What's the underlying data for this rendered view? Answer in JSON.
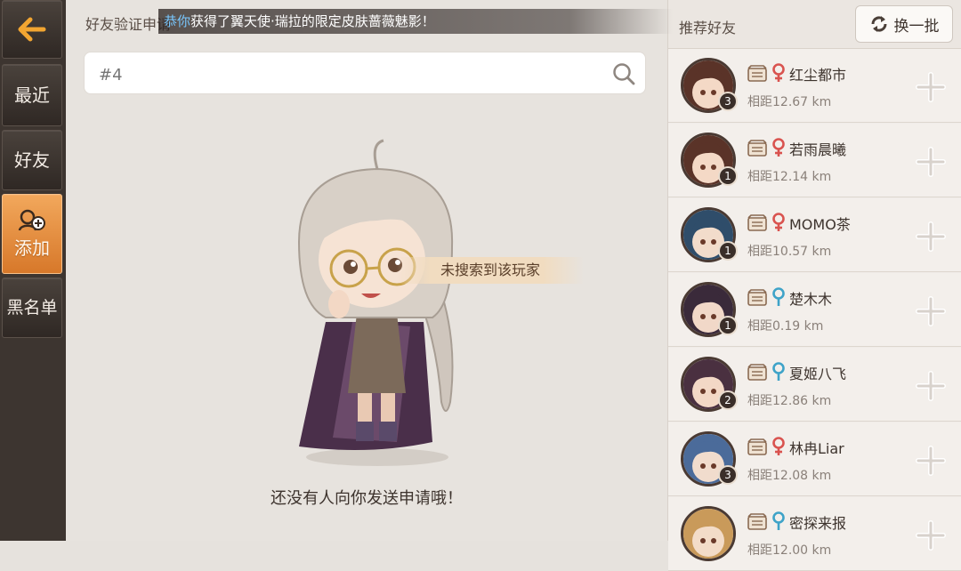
{
  "sidebar": {
    "back_label": "",
    "items": [
      {
        "label": "最近"
      },
      {
        "label": "好友"
      },
      {
        "label": "添加"
      },
      {
        "label": "黑名单"
      }
    ]
  },
  "main": {
    "title": "好友验证申请",
    "marquee_prefix": "恭你",
    "marquee_text": "获得了翼天使·瑞拉的限定皮肤蔷薇魅影！",
    "search_placeholder": "#4",
    "tip": "未搜索到该玩家",
    "empty_message": "还没有人向你发送申请哦！"
  },
  "recommend": {
    "title": "推荐好友",
    "refresh_label": "换一批",
    "items": [
      {
        "name": "红尘都市",
        "distance": "相距12.67 km",
        "level": "3",
        "gender": "female",
        "avatar_hair": "#5a3328",
        "avatar_skin": "#f4d9c6"
      },
      {
        "name": "若雨晨曦",
        "distance": "相距12.14 km",
        "level": "1",
        "gender": "female",
        "avatar_hair": "#5a3328",
        "avatar_skin": "#f4d9c6"
      },
      {
        "name": "MOMO茶",
        "distance": "相距10.57 km",
        "level": "1",
        "gender": "female",
        "avatar_hair": "#2f4d6a",
        "avatar_skin": "#f2dccb"
      },
      {
        "name": "楚木木",
        "distance": "相距0.19 km",
        "level": "1",
        "gender": "male",
        "avatar_hair": "#3a2a3a",
        "avatar_skin": "#f1d8c8"
      },
      {
        "name": "夏姬八飞",
        "distance": "相距12.86 km",
        "level": "2",
        "gender": "male",
        "avatar_hair": "#4a3040",
        "avatar_skin": "#f3d8c6"
      },
      {
        "name": "林冉Liar",
        "distance": "相距12.08 km",
        "level": "3",
        "gender": "female",
        "avatar_hair": "#4b6b9a",
        "avatar_skin": "#f1dccd"
      },
      {
        "name": "密探来报",
        "distance": "相距12.00 km",
        "level": "",
        "gender": "male",
        "avatar_hair": "#c99a5a",
        "avatar_skin": "#f3dcc8"
      }
    ]
  },
  "colors": {
    "accent_orange": "#e58b38",
    "female": "#d9534f",
    "male": "#3ea3c8",
    "sidebar_bg": "#3d3530"
  }
}
